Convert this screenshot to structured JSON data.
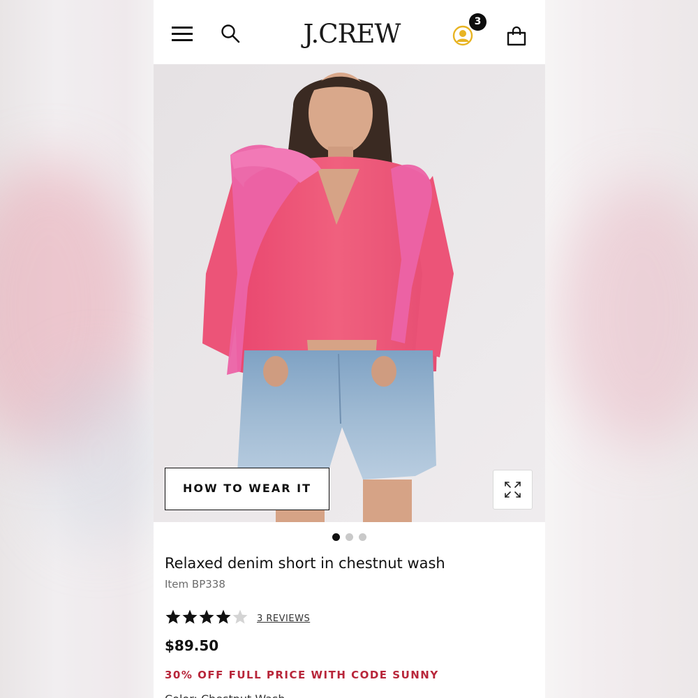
{
  "brand": {
    "logo_text": "J.CREW",
    "accent_color": "#e8b423",
    "promo_color": "#b8263a"
  },
  "header": {
    "menu_icon": "hamburger-menu-icon",
    "search_icon": "search-icon",
    "account_icon": "account-icon",
    "bag_icon": "shopping-bag-icon",
    "bag_count": "3"
  },
  "hero": {
    "how_to_wear_label": "HOW TO WEAR IT",
    "expand_icon": "expand-icon",
    "carousel_total": 3,
    "carousel_active": 1
  },
  "product": {
    "title": "Relaxed denim short in chestnut wash",
    "item_number": "Item BP338",
    "rating": 4,
    "rating_max": 5,
    "reviews_label": "3 REVIEWS",
    "price": "$89.50",
    "promo": "30% OFF FULL PRICE WITH CODE SUNNY",
    "color_label": "Color: Chestnut Wash"
  }
}
